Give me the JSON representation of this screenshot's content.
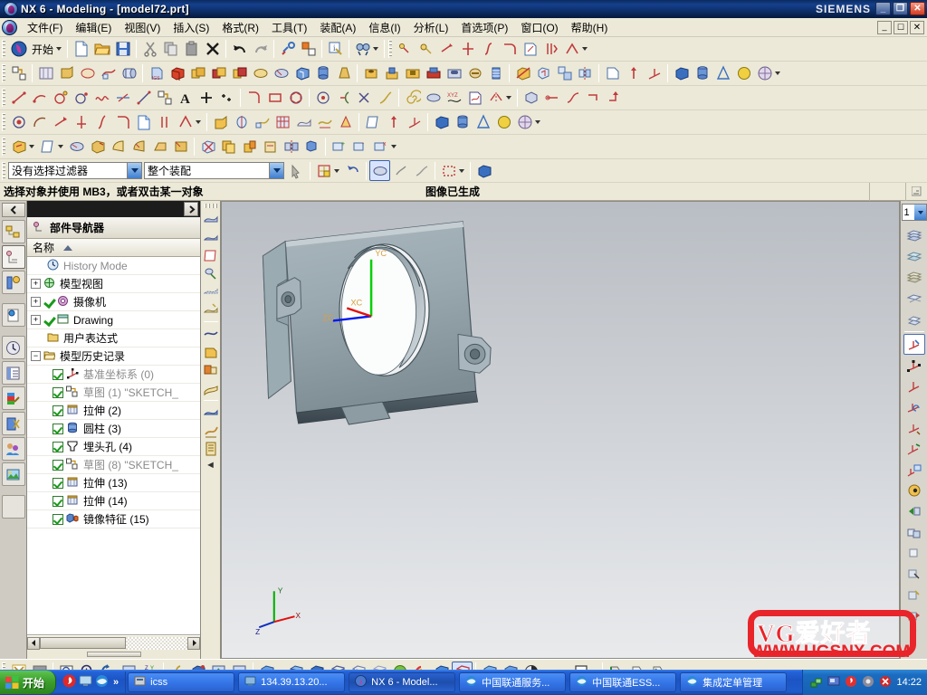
{
  "window": {
    "title": "NX 6 - Modeling - [model72.prt]",
    "brand": "SIEMENS",
    "minimize": "_",
    "maximize": "❐",
    "close": "✕"
  },
  "menubar": {
    "items": [
      {
        "label": "文件(F)",
        "name": "menu-file"
      },
      {
        "label": "编辑(E)",
        "name": "menu-edit"
      },
      {
        "label": "视图(V)",
        "name": "menu-view"
      },
      {
        "label": "插入(S)",
        "name": "menu-insert"
      },
      {
        "label": "格式(R)",
        "name": "menu-format"
      },
      {
        "label": "工具(T)",
        "name": "menu-tools"
      },
      {
        "label": "装配(A)",
        "name": "menu-assemblies"
      },
      {
        "label": "信息(I)",
        "name": "menu-information"
      },
      {
        "label": "分析(L)",
        "name": "menu-analysis"
      },
      {
        "label": "首选项(P)",
        "name": "menu-preferences"
      },
      {
        "label": "窗口(O)",
        "name": "menu-window"
      },
      {
        "label": "帮助(H)",
        "name": "menu-help"
      }
    ]
  },
  "standard_toolbar": {
    "start_label": "开始",
    "buttons": [
      "new-icon",
      "open-icon",
      "save-icon",
      "cut-icon",
      "copy-icon",
      "paste-icon",
      "delete-icon",
      "undo-icon",
      "redo-icon",
      "link-icon",
      "window-arrange-icon",
      "info-icon",
      "find-icon"
    ]
  },
  "feature_toolbar": {
    "buttons": [
      "sketch-icon",
      "datum-plane-icon",
      "extrude-icon",
      "revolve-icon",
      "sweep-icon",
      "tube-icon",
      "import-icon",
      "block-icon",
      "boolean-unite-icon",
      "boolean-subtract-icon",
      "boolean-intersect-icon",
      "blend-icon",
      "chamfer-icon",
      "shell-icon",
      "cylinder-icon",
      "draft-icon",
      "pattern-icon",
      "hole-icon",
      "boss-icon",
      "pocket-icon",
      "pad-icon",
      "slot-icon",
      "groove-icon",
      "thread-icon",
      "trim-icon",
      "offset-icon",
      "scale-icon",
      "mirror-icon",
      "datum-csys-icon",
      "point-icon",
      "cone-icon",
      "sphere-icon",
      "instance-icon"
    ]
  },
  "curve_toolbar": {
    "buttons": [
      "line-icon",
      "arc-icon",
      "circle-icon",
      "arc-point-icon",
      "spline-icon",
      "helix-icon",
      "law-curve-icon",
      "sketch-curve-icon",
      "text-icon",
      "point-plus-icon",
      "point-set-icon",
      "fillet-icon",
      "rectangle-icon",
      "polygon-icon",
      "offset-curve-icon",
      "bridge-curve-icon",
      "trim-curve-icon",
      "divide-curve-icon",
      "spiral-icon",
      "xyz-curve-icon",
      "project-curve-icon",
      "mirror-curve-icon",
      "combine-curve-icon"
    ]
  },
  "sketch_toolbar": {
    "buttons": [
      "finish-sketch-icon",
      "profile-icon",
      "line2-icon",
      "arc2-icon",
      "circle2-icon",
      "fillet2-icon",
      "rectangle2-icon",
      "point2-icon",
      "offset2-icon",
      "constraint-icon",
      "auto-constraint-icon",
      "dim-inferred-icon",
      "dim-horizontal-icon",
      "dim-vertical-icon",
      "dim-parallel-icon",
      "dim-angular-icon",
      "dim-radial-icon",
      "dim-diameter-icon",
      "dim-perimeter-icon"
    ]
  },
  "synch_toolbar": {
    "buttons": [
      "move-face-icon",
      "pull-face-icon",
      "offset-region-icon",
      "replace-face-icon",
      "resize-blend-icon",
      "reorder-blend-icon",
      "label-chamfer-icon",
      "delete-face-icon",
      "copy-face-icon",
      "cut-face-icon",
      "paste-face-icon",
      "mirror-face-icon",
      "pattern-face-icon",
      "add-dim-icon",
      "linear-dim-icon",
      "angular-dim-icon",
      "radial-dim-icon",
      "shell-body-icon"
    ]
  },
  "selection_bar": {
    "filter": {
      "value": "没有选择过滤器",
      "placeholder": "没有选择过滤器",
      "options": [
        "没有选择过滤器"
      ]
    },
    "scope": {
      "value": "整个装配",
      "placeholder": "整个装配",
      "options": [
        "整个装配"
      ]
    },
    "buttons": [
      "select-general-icon",
      "snap-point-icon",
      "undo-selection-icon",
      "face-select-icon",
      "edge-select-icon",
      "curve-select-icon",
      "rectangle-select-icon",
      "solid-body-select-icon"
    ]
  },
  "cue_bar": {
    "message": "选择对象并使用 MB3，或者双击某一对象",
    "status": "图像已生成"
  },
  "resource_bar": {
    "tabs": [
      {
        "name": "assembly-navigator-tab",
        "icon": "assembly-navigator-icon"
      },
      {
        "name": "part-navigator-tab",
        "icon": "part-navigator-icon",
        "selected": true
      },
      {
        "name": "reuse-library-tab",
        "icon": "reuse-library-icon"
      },
      {
        "name": "web-browser-tab",
        "icon": "web-browser-icon"
      },
      {
        "name": "history-tab",
        "icon": "history-clock-icon"
      },
      {
        "name": "roles-tab",
        "icon": "roles-icon"
      },
      {
        "name": "system-materials-tab",
        "icon": "palette-icon"
      },
      {
        "name": "system-scenes-tab",
        "icon": "scissors-icon"
      },
      {
        "name": "system-visual-tab",
        "icon": "people-icon"
      },
      {
        "name": "system-image-tab",
        "icon": "image-icon"
      },
      {
        "name": "empty-tab",
        "icon": "blank-icon"
      }
    ]
  },
  "navigator": {
    "collapse_icon": "chevron-left-icon",
    "title": "部件导航器",
    "title_icon": "part-navigator-icon",
    "column_header": "名称",
    "sort_icon": "sort-ascending-icon",
    "tree": [
      {
        "label": "History Mode",
        "icon": "clock-icon",
        "expander": "",
        "check": "none",
        "dim": true,
        "indent": 1
      },
      {
        "label": "模型视图",
        "icon": "model-views-icon",
        "expander": "+",
        "check": "none",
        "dim": false,
        "indent": 0
      },
      {
        "label": "摄像机",
        "icon": "camera-icon",
        "expander": "+",
        "check": "tick",
        "dim": false,
        "indent": 0
      },
      {
        "label": "Drawing",
        "icon": "drawing-icon",
        "expander": "+",
        "check": "tick",
        "dim": false,
        "indent": 0
      },
      {
        "label": "用户表达式",
        "icon": "folder-icon",
        "expander": "",
        "check": "none",
        "dim": false,
        "indent": 1
      },
      {
        "label": "模型历史记录",
        "icon": "folder-open-icon",
        "expander": "-",
        "check": "none",
        "dim": false,
        "indent": 0
      },
      {
        "label": "基准坐标系 (0)",
        "icon": "datum-csys-icon",
        "expander": "",
        "check": "box",
        "dim": true,
        "indent": 2
      },
      {
        "label": "草图 (1) \"SKETCH_",
        "icon": "sketch-icon",
        "expander": "",
        "check": "box",
        "dim": true,
        "indent": 2
      },
      {
        "label": "拉伸 (2)",
        "icon": "extrude-icon",
        "expander": "",
        "check": "box",
        "dim": false,
        "indent": 2
      },
      {
        "label": "圆柱 (3)",
        "icon": "cylinder-icon",
        "expander": "",
        "check": "box",
        "dim": false,
        "indent": 2
      },
      {
        "label": "埋头孔 (4)",
        "icon": "countersink-hole-icon",
        "expander": "",
        "check": "box",
        "dim": false,
        "indent": 2
      },
      {
        "label": "草图 (8) \"SKETCH_",
        "icon": "sketch-icon",
        "expander": "",
        "check": "box",
        "dim": true,
        "indent": 2
      },
      {
        "label": "拉伸 (13)",
        "icon": "extrude-icon",
        "expander": "",
        "check": "box",
        "dim": false,
        "indent": 2
      },
      {
        "label": "拉伸 (14)",
        "icon": "extrude-icon",
        "expander": "",
        "check": "box",
        "dim": false,
        "indent": 2
      },
      {
        "label": "镜像特征 (15)",
        "icon": "mirror-feature-icon",
        "expander": "",
        "check": "box",
        "dim": false,
        "indent": 2
      }
    ],
    "hscroll": {
      "left": "◄",
      "right": "►"
    }
  },
  "mini_toolbar": {
    "buttons": [
      "sheet-body-icon",
      "sheet-body2-icon",
      "trim-sheet-icon",
      "extend-sheet-icon",
      "sew-icon",
      "thicken-icon",
      "through-curves-icon",
      "ruled-icon",
      "swept-icon",
      "n-sided-icon",
      "studio-surface-icon",
      "transition-icon",
      "law-extension-icon"
    ],
    "overflow": "◄"
  },
  "graphics": {
    "csys_labels": {
      "x": "XC",
      "y": "YC",
      "z": "ZC"
    },
    "corner_triad": {
      "x": "X",
      "y": "Y",
      "z": "Z"
    },
    "model_name": "model72"
  },
  "right_bar": {
    "layer_value": "1",
    "layer_options": [
      "1"
    ],
    "buttons": [
      "layer-settings-icon",
      "layer-visible-icon",
      "layer-category-icon",
      "move-to-layer-icon",
      "copy-to-layer-icon",
      "wcs-dynamics-icon",
      "wcs-origin-icon",
      "wcs-rotate-icon",
      "wcs-orient-icon",
      "wcs-zaxis-xaxis-icon",
      "wcs-change-icon",
      "wcs-display-icon",
      "wcs-save-icon",
      "dynamic-wcs-icon",
      "hide-icon",
      "show-hide-icon",
      "show-all-icon",
      "invert-show-icon",
      "reverse-blank-icon",
      "edit-object-display-icon"
    ],
    "overflow": "»"
  },
  "view_toolbar": {
    "buttons": [
      "fit-icon",
      "fit-region-icon",
      "zoom-window-icon",
      "zoom-icon",
      "rotate-icon",
      "pan-icon",
      "wcs-view-icon",
      "perspective-icon",
      "view-section-icon",
      "restore-view-icon",
      "save-view-icon",
      "shaded-icon",
      "shaded-edges-icon",
      "partially-shaded-icon",
      "static-wireframe-icon",
      "wireframe-hidden-icon",
      "studio-icon",
      "face-analysis-icon",
      "rainbow-icon",
      "trimetric-icon",
      "isometric-icon",
      "top-view-icon",
      "front-view-icon",
      "pie-icon",
      "background-icon",
      "color-swatch-icon",
      "true-shading-icon",
      "entity-display-icon",
      "section-view-icon"
    ]
  },
  "taskbar": {
    "start_label": "开始",
    "quicklaunch": [
      "flame-icon",
      "monitor-icon",
      "ie-icon"
    ],
    "overflow": "»",
    "tasks": [
      {
        "label": "icss",
        "icon": "app-icon",
        "active": false
      },
      {
        "label": "134.39.13.20...",
        "icon": "remote-desktop-icon",
        "active": false
      },
      {
        "label": "NX 6 - Model...",
        "icon": "nx-icon",
        "active": true
      },
      {
        "label": "中国联通服务...",
        "icon": "ie-icon",
        "active": false
      },
      {
        "label": "中国联通ESS...",
        "icon": "ie-icon",
        "active": false
      },
      {
        "label": "集成定单管理",
        "icon": "ie-icon",
        "active": false
      }
    ],
    "tray_icons": [
      "network-icon",
      "screen-icon",
      "audio-icon",
      "shield-icon",
      "antivirus-icon"
    ],
    "clock": "14:22"
  },
  "watermark": {
    "line1": "VG爱好者",
    "line2": "WWW.UGSNX.COM",
    "color": "#e8252a"
  },
  "colors": {
    "titlebar": "#15408c",
    "chrome": "#ece9d8",
    "accent": "#3f7fd0",
    "taskbar": "#1c54c4",
    "start_green": "#3da02e"
  }
}
